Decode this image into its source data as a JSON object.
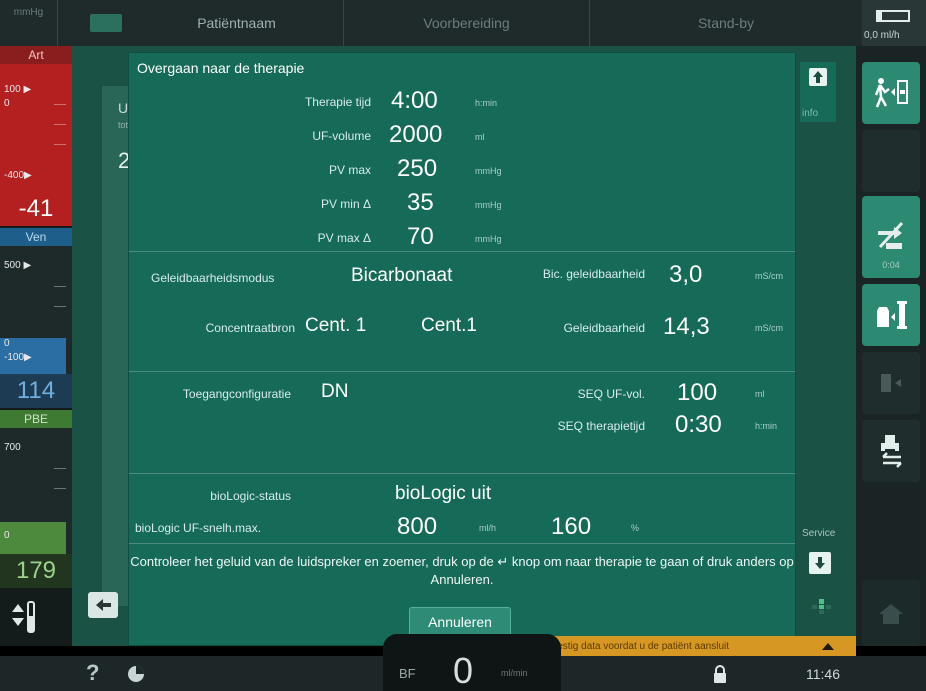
{
  "topbar": {
    "unit": "mmHg",
    "patient_name": "Patiëntnaam",
    "phase": "Voorbereiding",
    "mode": "Stand-by",
    "uf_rate": "0,0 ml/h"
  },
  "left": {
    "art_label": "Art",
    "art_scale_top": "100 ▶",
    "art_scale_zero": "0",
    "art_scale_bottom": "-400▶",
    "art_value": "-41",
    "ven_label": "Ven",
    "ven_scale_top": "500 ▶",
    "ven_scale_zero": "0",
    "ven_scale_bottom": "-100▶",
    "ven_value": "114",
    "pbe_label": "PBE",
    "pbe_scale_top": "700",
    "pbe_scale_zero": "0",
    "pbe_value": "179"
  },
  "background": {
    "uf_partial": "U",
    "tot_partial": "tot",
    "value_partial": "2"
  },
  "dialog": {
    "title": "Overgaan naar de therapie",
    "therapy_time": {
      "label": "Therapie tijd",
      "value": "4:00",
      "unit": "h:min"
    },
    "uf_volume": {
      "label": "UF-volume",
      "value": "2000",
      "unit": "ml"
    },
    "pv_max": {
      "label": "PV max",
      "value": "250",
      "unit": "mmHg"
    },
    "pv_min_delta": {
      "label": "PV min Δ",
      "value": "35",
      "unit": "mmHg"
    },
    "pv_max_delta": {
      "label": "PV max Δ",
      "value": "70",
      "unit": "mmHg"
    },
    "cond_mode": {
      "label": "Geleidbaarheidsmodus",
      "value": "Bicarbonaat"
    },
    "bic_cond": {
      "label": "Bic. geleidbaarheid",
      "value": "3,0",
      "unit": "mS/cm"
    },
    "conc_source": {
      "label": "Concentraatbron",
      "value1": "Cent. 1",
      "value2": "Cent.1"
    },
    "conductivity": {
      "label": "Geleidbaarheid",
      "value": "14,3",
      "unit": "mS/cm"
    },
    "access_config": {
      "label": "Toegangconfiguratie",
      "value": "DN"
    },
    "seq_uf_vol": {
      "label": "SEQ UF-vol.",
      "value": "100",
      "unit": "ml"
    },
    "seq_time": {
      "label": "SEQ therapietijd",
      "value": "0:30",
      "unit": "h:min"
    },
    "biologic_status": {
      "label": "bioLogic-status",
      "value": "bioLogic uit"
    },
    "biologic_uf": {
      "label": "bioLogic UF-snelh.max.",
      "value": "800",
      "unit": "ml/h",
      "value2": "160",
      "unit2": "%"
    },
    "message": "Controleer het geluid van de luidspreker en zoemer, druk op de ↵ knop om naar therapie te gaan of druk anders op Annuleren.",
    "cancel_label": "Annuleren"
  },
  "side": {
    "info_label": "info",
    "service_label": "Service",
    "timer_label": "0:04"
  },
  "notice": "Bevestig data voordat u de patiënt aansluit",
  "bottombar": {
    "help": "?",
    "bf_label": "BF",
    "bf_value": "0",
    "bf_unit": "ml/min",
    "time": "11:46"
  }
}
